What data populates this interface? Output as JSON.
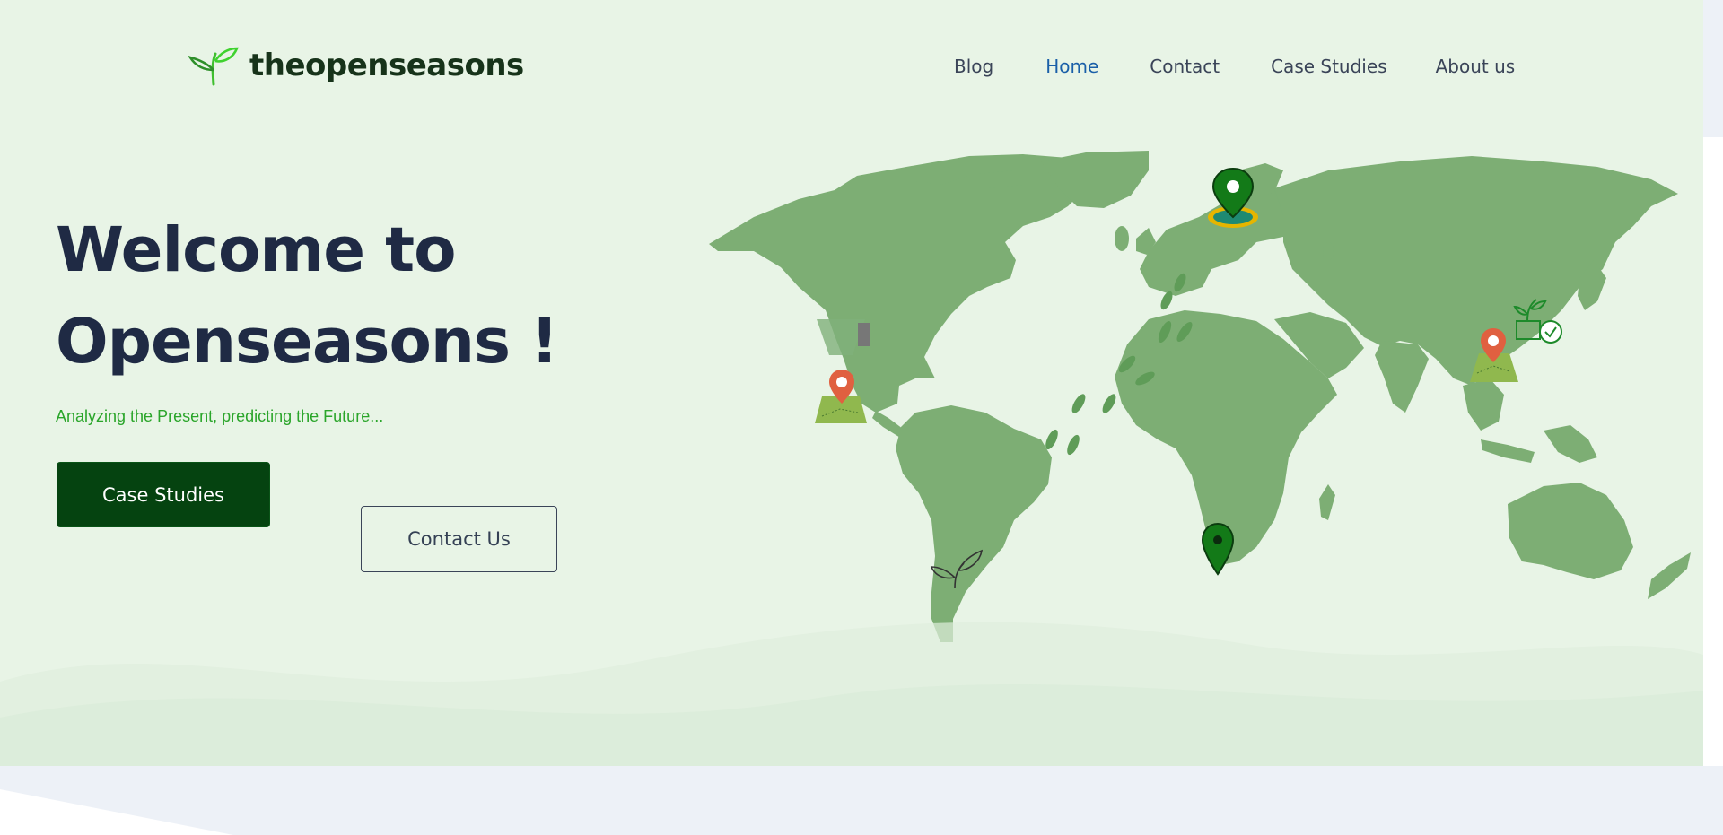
{
  "header": {
    "logo_text": "theopenseasons",
    "nav": [
      {
        "label": "Blog",
        "active": false
      },
      {
        "label": "Home",
        "active": true
      },
      {
        "label": "Contact",
        "active": false
      },
      {
        "label": "Case Studies",
        "active": false
      },
      {
        "label": "About us",
        "active": false
      }
    ]
  },
  "hero": {
    "title_line1": "Welcome to",
    "title_line2": "Openseasons !",
    "tagline": "Analyzing the Present, predicting the Future...",
    "primary_button": "Case Studies",
    "secondary_button": "Contact Us"
  },
  "colors": {
    "hero_background": "#e8f4e6",
    "map_land": "#7dae74",
    "primary_button": "#054310",
    "title": "#1f2a44",
    "tagline": "#2aa52a",
    "nav_active": "#1a5fa8"
  },
  "icons": [
    "sprout-logo-icon",
    "map-pin-icon",
    "leaf-icon",
    "plant-check-icon",
    "footprints-icon"
  ]
}
